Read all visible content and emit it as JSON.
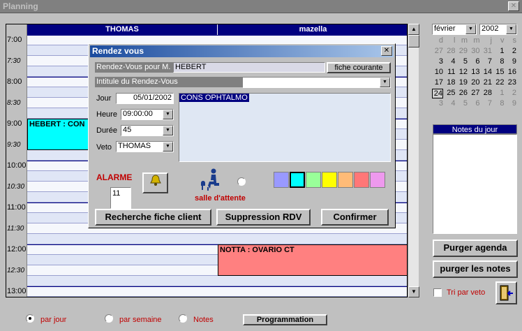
{
  "window": {
    "title": "Planning",
    "close": "✕"
  },
  "grid": {
    "columns": [
      "THOMAS",
      "mazella"
    ],
    "times": [
      "7:00",
      "7:30",
      "8:00",
      "8:30",
      "9:00",
      "9:30",
      "10:00",
      "10:30",
      "11:00",
      "11:30",
      "12:00",
      "12:30",
      "13:00"
    ],
    "appointments": [
      {
        "text": "HEBERT : CON",
        "color": "#00ffff"
      },
      {
        "text": "NOTTA : OVARIO CT",
        "color": "#ff8080"
      }
    ]
  },
  "dialog": {
    "title": "Rendez vous",
    "pour_label": "Rendez-Vous pour M.",
    "pour_value": "HEBERT",
    "fiche_button": "fiche courante",
    "intitule_label": "Intitule du Rendez-Vous",
    "intitule_value": "",
    "jour_label": "Jour",
    "jour_value": "05/01/2002",
    "heure_label": "Heure",
    "heure_value": "09:00:00",
    "duree_label": "Durée",
    "duree_value": "45",
    "veto_label": "Veto",
    "veto_value": "THOMAS",
    "memo": "CONS OPHTALMO",
    "alarme_label": "ALARME",
    "alarme_value": "11",
    "salle_label": "salle d'attente",
    "colors": [
      "#9999ff",
      "#00ffff",
      "#99ff99",
      "#ffff00",
      "#ffbb77",
      "#ff7777",
      "#ee99ee"
    ],
    "selected_color": "#00ffff",
    "buttons": {
      "recherche": "Recherche fiche client",
      "suppression": "Suppression RDV",
      "confirmer": "Confirmer"
    },
    "icons": {
      "alarm": "alarm-bell-icon",
      "waiting": "waiting-room-icon"
    }
  },
  "calendar": {
    "month": "février",
    "year": "2002",
    "weekdays": [
      "d",
      "l",
      "m",
      "m",
      "j",
      "v",
      "s"
    ],
    "weeks": [
      [
        "27",
        "28",
        "29",
        "30",
        "31",
        "1",
        "2"
      ],
      [
        "3",
        "4",
        "5",
        "6",
        "7",
        "8",
        "9"
      ],
      [
        "10",
        "11",
        "12",
        "13",
        "14",
        "15",
        "16"
      ],
      [
        "17",
        "18",
        "19",
        "20",
        "21",
        "22",
        "23"
      ],
      [
        "24",
        "25",
        "26",
        "27",
        "28",
        "1",
        "2"
      ],
      [
        "3",
        "4",
        "5",
        "6",
        "7",
        "8",
        "9"
      ]
    ],
    "selected": "24"
  },
  "notes": {
    "header": "Notes du jour",
    "content": ""
  },
  "right_buttons": {
    "purger_agenda": "Purger agenda",
    "purger_notes": "purger les notes"
  },
  "tri": {
    "label": "Tri par veto",
    "checked": false
  },
  "bottom": {
    "par_jour": "par jour",
    "par_semaine": "par semaine",
    "notes": "Notes",
    "programmation": "Programmation",
    "selected": "par jour"
  }
}
